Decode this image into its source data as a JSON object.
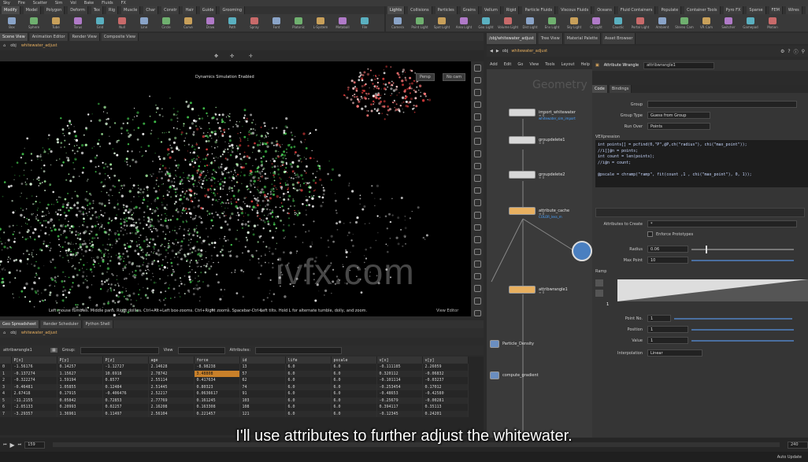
{
  "menubar": {
    "items": [
      "Sky",
      "Fire",
      "Scatter",
      "Sim",
      "Vol",
      "Bake",
      "Fluids",
      "FX"
    ]
  },
  "shelf_left": {
    "tabs": [
      "Modify",
      "Model",
      "Polygon",
      "Deform",
      "Tex",
      "Rig",
      "Muscle",
      "Char",
      "Constr",
      "Hair",
      "Guide",
      "Grooming"
    ],
    "tools": [
      "Box",
      "Sphere",
      "Tube",
      "Torus",
      "Grid",
      "Null",
      "Line",
      "Circle",
      "Curve",
      "Draw",
      "Path",
      "Spray",
      "Font",
      "Platonic",
      "L-System",
      "Metaball",
      "File"
    ]
  },
  "shelf_right": {
    "tabs": [
      "Lights",
      "Collisions",
      "Particles",
      "Grains",
      "Vellum",
      "Rigid",
      "Particle Fluids",
      "Viscous Fluids",
      "Oceans",
      "Fluid Containers",
      "Populate",
      "Container Tools",
      "Pyro FX",
      "Sparse",
      "FEM",
      "Wires",
      "Crowds",
      "Drive"
    ],
    "tools": [
      "Camera",
      "Point Light",
      "Spot Light",
      "Area Light",
      "Geo Light",
      "Volume Light",
      "Dist Light",
      "Env Light",
      "Sky Light",
      "GI Light",
      "Caustic",
      "Portal Light",
      "Ambient",
      "Stereo Cam",
      "VR Cam",
      "Switcher",
      "Gamepad",
      "Motion"
    ]
  },
  "viewport": {
    "tabs": [
      "Scene View",
      "Animation Editor",
      "Render View",
      "Composite View"
    ],
    "path": [
      "obj",
      "whitewater_adjust"
    ],
    "message": "Dynamics Simulation Enabled",
    "camera_btn": "Persp",
    "cam_btn": "No cam",
    "status": "Left mouse tumbles. Middle pans. Right dollies. Ctrl+Alt+Left box-zooms. Ctrl+Right zooms. Spacebar-Ctrl-Left tilts. Hold L for alternate tumble, dolly, and zoom.",
    "state": "View Editor"
  },
  "spreadsheet": {
    "tabs": [
      "Geo Spreadsheet",
      "Render Scheduler",
      "Python Shell"
    ],
    "path": [
      "obj",
      "whitewater_adjust"
    ],
    "node": "attribwrangle1",
    "group_label": "Group:",
    "view_label": "View",
    "attrib_label": "Attributes:",
    "columns": [
      "",
      "P[x]",
      "P[y]",
      "P[z]",
      "age",
      "force",
      "id",
      "life",
      "pscale",
      "v[x]",
      "v[y]"
    ],
    "rows": [
      [
        "0",
        "-1.56176",
        "0.14257",
        "-1.12727",
        "2.14628",
        "-8.98238",
        "13",
        "6.0",
        "6.0",
        "-0.111185",
        "2.26059"
      ],
      [
        "1",
        "-0.137274",
        "1.15627",
        "10.6918",
        "2.78742",
        "3.48808",
        "57",
        "6.0",
        "6.0",
        "0.320112",
        "-0.06832"
      ],
      [
        "2",
        "-0.322274",
        "1.59194",
        "0.8577",
        "2.55114",
        "0.417634",
        "62",
        "6.0",
        "6.0",
        "-0.101114",
        "-0.03237"
      ],
      [
        "3",
        "-0.46481",
        "1.05855",
        "0.12484",
        "2.51445",
        "0.80323",
        "74",
        "6.0",
        "6.0",
        "-0.253454",
        "0.17012"
      ],
      [
        "4",
        "2.67418",
        "0.17915",
        "-0.406476",
        "2.52217",
        "0.0636617",
        "91",
        "6.0",
        "6.0",
        "-0.48653",
        "-0.42580"
      ],
      [
        "5",
        "-11.2155",
        "0.05842",
        "0.72853",
        "2.77769",
        "0.161245",
        "103",
        "6.0",
        "6.0",
        "-0.25679",
        "-0.00281"
      ],
      [
        "6",
        "-2.05133",
        "0.20993",
        "0.02257",
        "2.16208",
        "0.163308",
        "108",
        "6.0",
        "6.0",
        "0.394117",
        "0.35113"
      ],
      [
        "7",
        "-3.29357",
        "1.36961",
        "0.11497",
        "2.56104",
        "0.221457",
        "121",
        "6.0",
        "6.0",
        "-0.12345",
        "0.24201"
      ]
    ],
    "highlight_cell": "1-5"
  },
  "network": {
    "tabs": [
      "/obj/whitewater_adjust",
      "Tree View",
      "Material Palette",
      "Asset Browser"
    ],
    "path": [
      "obj",
      "whitewater_adjust"
    ],
    "menu": [
      "Add",
      "Edit",
      "Go",
      "View",
      "Tools",
      "Layout",
      "Help"
    ],
    "title": "Geometry",
    "nodes": [
      {
        "name": "import_whitewater",
        "sub": "whitewater_sim_import",
        "count": "≡ 0"
      },
      {
        "name": "groupdelete1",
        "sub": "",
        "count": "≡ 0"
      },
      {
        "name": "groupdelete2",
        "sub": "",
        "count": "≡ 0"
      },
      {
        "name": "attribute_cache",
        "sub": "COLOR_less_m",
        "count": "≡ 0"
      },
      {
        "name": "attribwrangle1",
        "sub": "",
        "count": "≡ 0"
      },
      {
        "name": "Particle_Density",
        "sub": "",
        "count": ""
      },
      {
        "name": "compute_gradient",
        "sub": "",
        "count": ""
      }
    ]
  },
  "params": {
    "node_type": "Attribute Wrangle",
    "node_name": "attribwrangle1",
    "tabs": [
      "Code",
      "Bindings"
    ],
    "group_label": "Group",
    "group_type_label": "Group Type",
    "group_type_value": "Guess from Group",
    "run_over_label": "Run Over",
    "run_over_value": "Points",
    "vex_label": "VEXpression",
    "vex_code": "int points[] = pcfind(0,\"P\",@P,ch(\"radius\"), chi(\"max_point\"));\n//i[]@n = points;\nint count = len(points);\n//i@n = count;\n\n@pscale = chramp(\"ramp\", fit(count ,1 , chi(\"max_point\"), 0, 1));",
    "attrs_to_create_label": "Attributes to Create",
    "attrs_to_create_value": "*",
    "enforce_label": "Enforce Prototypes",
    "radius_label": "Radius",
    "radius_value": "0.06",
    "max_point_label": "Max Point",
    "max_point_value": "10",
    "ramp_label": "Ramp",
    "ramp_index": "1",
    "position_label": "Point No.",
    "position_value": "1",
    "value_label": "Position",
    "value_value": "1",
    "value2_label": "Value",
    "value2_value": "1",
    "interp_label": "Interpolation",
    "interp_value": "Linear"
  },
  "timeline": {
    "frame": "159",
    "end_frame": "240",
    "fps_label": "Auto Update"
  },
  "subtitle": "I'll use attributes to further adjust the whitewater.",
  "watermark": "ivfx.com",
  "colors": {
    "accent_orange": "#e8b060",
    "link_blue": "#4aa3ff",
    "particles_green": "#3fbf4a",
    "particles_red": "#d83a3a"
  }
}
